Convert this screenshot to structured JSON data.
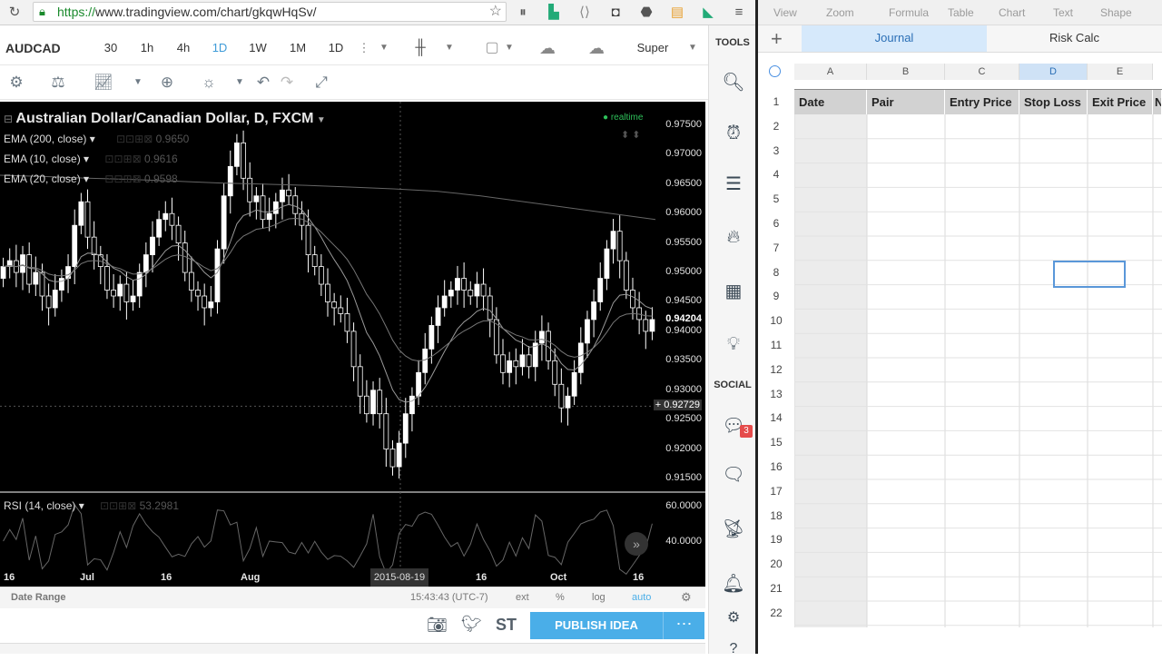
{
  "browser": {
    "url_scheme": "https://",
    "url_rest": "www.tradingview.com/chart/gkqwHqSv/"
  },
  "tv": {
    "symbol": "AUDCAD",
    "intervals": [
      "30",
      "1h",
      "4h",
      "1D",
      "1W",
      "1M",
      "1D"
    ],
    "active_interval": "1D",
    "super_label": "Super",
    "tools_label": "TOOLS",
    "social_label": "SOCIAL",
    "notification_count": "3"
  },
  "chart_data": {
    "type": "candlestick",
    "title": "Australian Dollar/Canadian Dollar, D, FXCM",
    "status": "realtime",
    "indicators": [
      {
        "name": "EMA (200, close)",
        "value": "0.9650"
      },
      {
        "name": "EMA (10, close)",
        "value": "0.9616"
      },
      {
        "name": "EMA (20, close)",
        "value": "0.9598"
      }
    ],
    "y_ticks": [
      "0.97500",
      "0.97000",
      "0.96500",
      "0.96000",
      "0.95500",
      "0.95000",
      "0.94500",
      "0.94000",
      "0.93500",
      "0.93000",
      "0.92500",
      "0.92000",
      "0.91500"
    ],
    "ylim": [
      0.913,
      0.979
    ],
    "last_price": "0.94204",
    "crosshair_price": "0.92729",
    "x_ticks": [
      "16",
      "Jul",
      "16",
      "Aug",
      "16",
      "Oct",
      "16"
    ],
    "crosshair_date": "2015-08-19",
    "closes": [
      0.951,
      0.952,
      0.95,
      0.953,
      0.948,
      0.95,
      0.946,
      0.944,
      0.947,
      0.949,
      0.951,
      0.958,
      0.962,
      0.956,
      0.953,
      0.951,
      0.947,
      0.946,
      0.948,
      0.945,
      0.946,
      0.95,
      0.953,
      0.956,
      0.959,
      0.96,
      0.958,
      0.955,
      0.95,
      0.947,
      0.946,
      0.944,
      0.945,
      0.954,
      0.963,
      0.968,
      0.972,
      0.966,
      0.962,
      0.963,
      0.959,
      0.96,
      0.962,
      0.964,
      0.963,
      0.96,
      0.958,
      0.953,
      0.951,
      0.948,
      0.945,
      0.944,
      0.943,
      0.94,
      0.934,
      0.929,
      0.926,
      0.93,
      0.926,
      0.92,
      0.917,
      0.921,
      0.926,
      0.929,
      0.933,
      0.937,
      0.941,
      0.944,
      0.946,
      0.947,
      0.949,
      0.947,
      0.946,
      0.948,
      0.946,
      0.942,
      0.936,
      0.933,
      0.935,
      0.934,
      0.936,
      0.934,
      0.938,
      0.94,
      0.935,
      0.931,
      0.927,
      0.929,
      0.933,
      0.938,
      0.942,
      0.945,
      0.949,
      0.954,
      0.957,
      0.952,
      0.947,
      0.944,
      0.942,
      0.94,
      0.942
    ],
    "ema_200": [
      0.9665,
      0.9663,
      0.966,
      0.9658,
      0.9655,
      0.9652,
      0.965,
      0.9648,
      0.9645,
      0.9642,
      0.9638,
      0.963,
      0.962,
      0.961,
      0.96,
      0.959
    ],
    "rsi": {
      "name": "RSI (14, close)",
      "value": "53.2981",
      "y_ticks": [
        "60.0000",
        "40.0000"
      ]
    }
  },
  "bottom": {
    "date_range": "Date Range",
    "time": "15:43:43 (UTC-7)",
    "ext": "ext",
    "pct": "%",
    "log": "log",
    "auto": "auto",
    "st": "ST",
    "publish": "PUBLISH IDEA",
    "more": "⋯"
  },
  "numbers": {
    "toolbar": [
      "View",
      "Zoom",
      "Formula",
      "Table",
      "Chart",
      "Text",
      "Shape"
    ],
    "tabs": [
      "Journal",
      "Risk Calc"
    ],
    "columns": [
      "A",
      "B",
      "C",
      "D",
      "E"
    ],
    "headers": [
      "Date",
      "Pair",
      "Entry Price",
      "Stop Loss",
      "Exit Price",
      "N"
    ],
    "rows": [
      "1",
      "2",
      "3",
      "4",
      "5",
      "6",
      "7",
      "8",
      "9",
      "10",
      "11",
      "12",
      "13",
      "14",
      "15",
      "16",
      "17",
      "18",
      "19",
      "20",
      "21",
      "22"
    ]
  },
  "colors": {
    "accent": "#4aaee8",
    "bull": "#ffffff",
    "bear": "#000000",
    "grid_header": "#d2d2d2"
  }
}
